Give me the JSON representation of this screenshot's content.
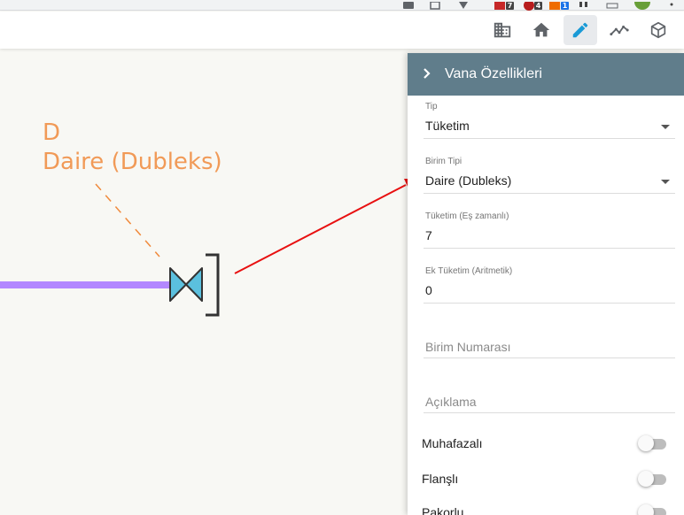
{
  "browser": {
    "extensions": [
      {
        "name": "extension-1",
        "badge": "7",
        "badge_color": "#444444"
      },
      {
        "name": "extension-2",
        "badge": "4",
        "badge_color": "#444444"
      },
      {
        "name": "extension-3",
        "badge": "1",
        "badge_color": "#1a73e8"
      }
    ]
  },
  "toolbar": {
    "buttons": [
      {
        "name": "building-icon"
      },
      {
        "name": "home-icon"
      },
      {
        "name": "pencil-icon",
        "active": true,
        "color": "#1a9ad6"
      },
      {
        "name": "line-chart-icon"
      },
      {
        "name": "cube-icon"
      }
    ]
  },
  "canvas": {
    "label_code": "D",
    "label_name": "Daire (Dubleks)",
    "pipe_color": "#b388ff",
    "label_color": "#f08a3c",
    "valve_color": "#5bc0de",
    "arrow_color": "#e81010"
  },
  "panel": {
    "title": "Vana Özellikleri",
    "header_color": "#607d8b",
    "fields": {
      "tip": {
        "label": "Tip",
        "value": "Tüketim"
      },
      "birim_tipi": {
        "label": "Birim Tipi",
        "value": "Daire (Dubleks)"
      },
      "tuketim": {
        "label": "Tüketim (Eş zamanlı)",
        "value": "7"
      },
      "ek_tuketim": {
        "label": "Ek Tüketim (Aritmetik)",
        "value": "0"
      },
      "birim_numarasi": {
        "placeholder": "Birim Numarası"
      },
      "aciklama": {
        "placeholder": "Açıklama"
      }
    },
    "toggles": [
      {
        "label": "Muhafazalı",
        "checked": false
      },
      {
        "label": "Flanşlı",
        "checked": false
      },
      {
        "label": "Pakorlu",
        "checked": false
      }
    ]
  }
}
